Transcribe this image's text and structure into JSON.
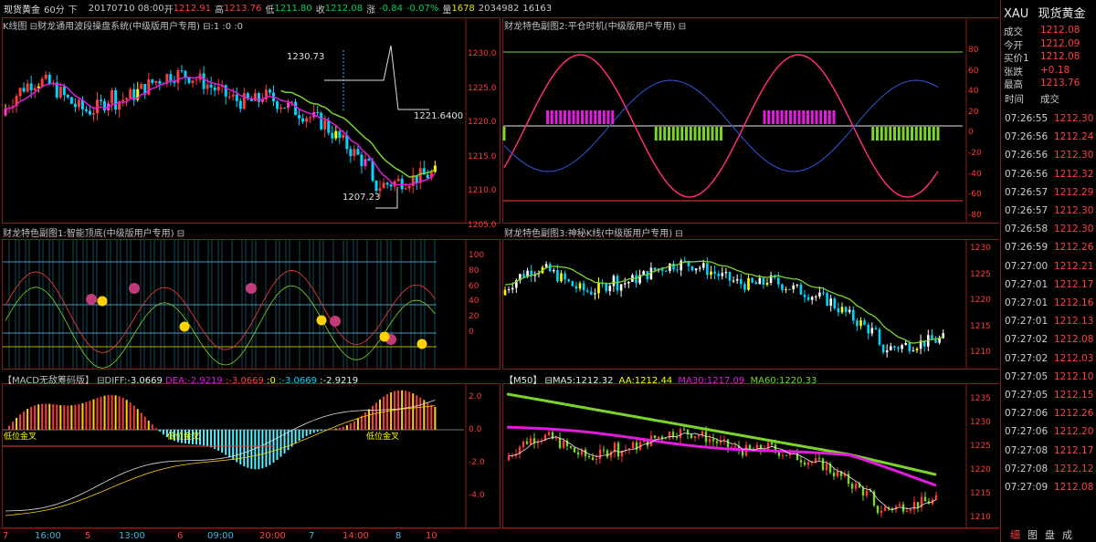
{
  "topbar": {
    "name": "现货黄金",
    "period": "60分",
    "arrow": "下",
    "date": "20170710 08:00",
    "open_label": "开",
    "open": "1212.91",
    "high_label": "高",
    "high": "1213.76",
    "low_label": "低",
    "low": "1211.80",
    "close_label": "收",
    "close": "1212.08",
    "change_label": "涨",
    "change": "-0.84",
    "change_pct": "-0.07%",
    "volume_label": "量",
    "volume": "1678",
    "amount": "2034982",
    "oi": "16163"
  },
  "panels": {
    "kline": {
      "title": "K线图 ⊟财龙通用波段操盘系统(中级版用户专用) ⊟:1 :0 :0",
      "ticks": [
        "1230.0",
        "1225.0",
        "1220.0",
        "1215.0",
        "1210.0",
        "1205.0"
      ],
      "annotations": {
        "peak": "1230.73",
        "mid": "1221.6400",
        "low": "1207.23"
      }
    },
    "sub1": {
      "title": "财龙特色副图1:智能顶底(中级版用户专用) ⊟",
      "ticks": [
        "100",
        "80",
        "60",
        "40",
        "20",
        "0"
      ]
    },
    "macd": {
      "title_prefix": "【MACD无敌筹码版】 ⊟DIFF:",
      "diff": "-3.0669",
      "dea_label": "DEA:",
      "dea": "-2.9219",
      "c3": ":-3.0669",
      "c4": ":0",
      "c5": ":-3.0669",
      "c6": ":-2.9219",
      "ticks": [
        "2.0",
        "0.0",
        "-2.0",
        "-4.0"
      ],
      "labels": [
        "低位金叉",
        "低位金叉",
        "低位金叉"
      ]
    },
    "sub2": {
      "title": "财龙特色副图2:平仓时机(中级版用户专用) ⊟",
      "ticks": [
        "80",
        "60",
        "40",
        "20",
        "0",
        "-20",
        "-40",
        "-60",
        "-80"
      ]
    },
    "sub3": {
      "title": "财龙特色副图3:神秘K线(中级版用户专用) ⊟",
      "ticks": [
        "1230",
        "1225",
        "1220",
        "1215",
        "1210"
      ]
    },
    "ma": {
      "title": "【M50】 ⊟MA5:1212.32",
      "aa": "AA:1212.44",
      "ma30": "MA30:1217.09",
      "ma60": "MA60:1220.33",
      "ticks": [
        "1235",
        "1230",
        "1225",
        "1220",
        "1215",
        "1210"
      ]
    }
  },
  "xaxis": {
    "left": [
      "7",
      "16:00",
      "5",
      "13:00",
      "6",
      "09:00",
      "20:00",
      "7",
      "14:00",
      "8",
      "10"
    ]
  },
  "colors": {
    "up": "#ff3b3b",
    "down": "#00d5ff",
    "frame": "#8b1a1a",
    "ma_pink": "#e21bde",
    "ma_green": "#7cd42b"
  },
  "side": {
    "symbol": "XAU",
    "name": "现货黄金",
    "quote": [
      {
        "label": "成交",
        "value": "1212.08"
      },
      {
        "label": "今开",
        "value": "1212.09"
      },
      {
        "label": "买价1",
        "value": "1212.08"
      },
      {
        "label": "张跌",
        "value": "+0.18"
      },
      {
        "label": "最高",
        "value": "1213.76"
      }
    ],
    "ticks_header": {
      "time": "时间",
      "price": "成交"
    },
    "ticks": [
      {
        "time": "07:26:55",
        "price": "1212.30"
      },
      {
        "time": "07:26:56",
        "price": "1212.24"
      },
      {
        "time": "07:26:56",
        "price": "1212.30"
      },
      {
        "time": "07:26:56",
        "price": "1212.32"
      },
      {
        "time": "07:26:57",
        "price": "1212.29"
      },
      {
        "time": "07:26:57",
        "price": "1212.30"
      },
      {
        "time": "07:26:58",
        "price": "1212.30"
      },
      {
        "time": "07:26:59",
        "price": "1212.26"
      },
      {
        "time": "07:27:00",
        "price": "1212.21"
      },
      {
        "time": "07:27:01",
        "price": "1212.17"
      },
      {
        "time": "07:27:01",
        "price": "1212.16"
      },
      {
        "time": "07:27:01",
        "price": "1212.13"
      },
      {
        "time": "07:27:02",
        "price": "1212.08"
      },
      {
        "time": "07:27:02",
        "price": "1212.03"
      },
      {
        "time": "07:27:05",
        "price": "1212.10"
      },
      {
        "time": "07:27:05",
        "price": "1212.15"
      },
      {
        "time": "07:27:06",
        "price": "1212.26"
      },
      {
        "time": "07:27:06",
        "price": "1212.20"
      },
      {
        "time": "07:27:08",
        "price": "1212.17"
      },
      {
        "time": "07:27:08",
        "price": "1212.12"
      },
      {
        "time": "07:27:09",
        "price": "1212.08"
      }
    ],
    "tabs": [
      "细",
      "图",
      "盘",
      "成"
    ]
  }
}
